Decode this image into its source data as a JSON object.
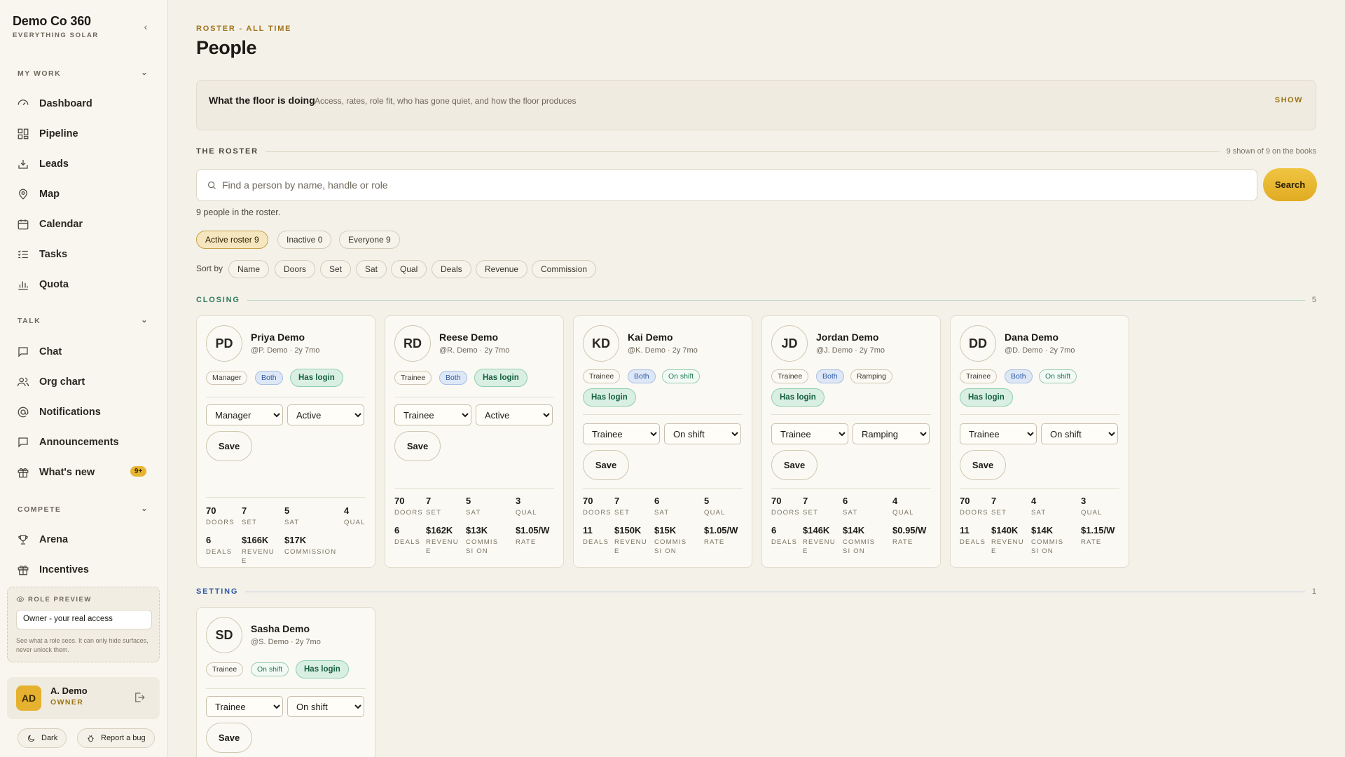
{
  "brand": {
    "title": "Demo Co 360",
    "subtitle": "EVERYTHING SOLAR"
  },
  "nav": {
    "my_work": "MY WORK",
    "talk": "TALK",
    "compete": "COMPETE",
    "items": {
      "dashboard": "Dashboard",
      "pipeline": "Pipeline",
      "leads": "Leads",
      "map": "Map",
      "calendar": "Calendar",
      "tasks": "Tasks",
      "quota": "Quota",
      "chat": "Chat",
      "org_chart": "Org chart",
      "notifications": "Notifications",
      "announcements": "Announcements",
      "whats_new": "What's new",
      "whats_new_badge": "9+",
      "arena": "Arena",
      "incentives": "Incentives"
    }
  },
  "role_preview": {
    "title": "ROLE PREVIEW",
    "value": "Owner - your real access",
    "help": "See what a role sees. It can only hide surfaces, never unlock them."
  },
  "user": {
    "initials": "AD",
    "name": "A. Demo",
    "role": "OWNER"
  },
  "footer": {
    "dark": "Dark",
    "bug": "Report a bug"
  },
  "header": {
    "eyebrow": "ROSTER - ALL TIME",
    "title": "People"
  },
  "floor": {
    "title": "What the floor is doing",
    "desc": "Access, rates, role fit, who has gone quiet, and how the floor produces",
    "show": "SHOW"
  },
  "roster": {
    "title": "THE ROSTER",
    "shown": "9 shown of 9 on the books",
    "search_placeholder": "Find a person by name, handle or role",
    "search_button": "Search",
    "count_text": "9 people in the roster.",
    "filters": {
      "active": "Active roster  9",
      "inactive": "Inactive  0",
      "everyone": "Everyone  9"
    },
    "sort_label": "Sort by",
    "sort": [
      "Name",
      "Doors",
      "Set",
      "Sat",
      "Qual",
      "Deals",
      "Revenue",
      "Commission"
    ]
  },
  "sections": {
    "closing": {
      "title": "CLOSING",
      "count": "5",
      "color": "#2f7a5a"
    },
    "setting": {
      "title": "SETTING",
      "count": "1",
      "color": "#2f5aa6"
    }
  },
  "stat_labels": {
    "doors": "DOORS",
    "set": "SET",
    "sat": "SAT",
    "qual": "QUAL",
    "deals": "DEALS",
    "revenue": "REVENUE",
    "commission": "COMMISSION",
    "commission_wrap": "COMMISSI ON",
    "rate": "RATE"
  },
  "save_label": "Save",
  "people": [
    {
      "initials": "PD",
      "name": "Priya Demo",
      "handle": "@P. Demo · 2y 7mo",
      "role_tag": "Manager",
      "mode_tag": "Both",
      "login": "Has login",
      "role_sel": "Manager",
      "status_sel": "Active",
      "doors": "70",
      "set": "7",
      "sat": "5",
      "qual": "4",
      "deals": "6",
      "revenue": "$166K",
      "commission": "$17K"
    },
    {
      "initials": "RD",
      "name": "Reese Demo",
      "handle": "@R. Demo · 2y 7mo",
      "role_tag": "Trainee",
      "mode_tag": "Both",
      "login": "Has login",
      "role_sel": "Trainee",
      "status_sel": "Active",
      "doors": "70",
      "set": "7",
      "sat": "5",
      "qual": "3",
      "deals": "6",
      "revenue": "$162K",
      "commission": "$13K",
      "rate": "$1.05/W"
    },
    {
      "initials": "KD",
      "name": "Kai Demo",
      "handle": "@K. Demo · 2y 7mo",
      "role_tag": "Trainee",
      "mode_tag": "Both",
      "status_tag": "On shift",
      "login": "Has login",
      "role_sel": "Trainee",
      "status_sel": "On shift",
      "doors": "70",
      "set": "7",
      "sat": "6",
      "qual": "5",
      "deals": "11",
      "revenue": "$150K",
      "commission": "$15K",
      "rate": "$1.05/W"
    },
    {
      "initials": "JD",
      "name": "Jordan Demo",
      "handle": "@J. Demo · 2y 7mo",
      "role_tag": "Trainee",
      "mode_tag": "Both",
      "status_tag": "Ramping",
      "login": "Has login",
      "role_sel": "Trainee",
      "status_sel": "Ramping",
      "doors": "70",
      "set": "7",
      "sat": "6",
      "qual": "4",
      "deals": "6",
      "revenue": "$146K",
      "commission": "$14K",
      "rate": "$0.95/W"
    },
    {
      "initials": "DD",
      "name": "Dana Demo",
      "handle": "@D. Demo · 2y 7mo",
      "role_tag": "Trainee",
      "mode_tag": "Both",
      "status_tag": "On shift",
      "login": "Has login",
      "role_sel": "Trainee",
      "status_sel": "On shift",
      "doors": "70",
      "set": "7",
      "sat": "4",
      "qual": "3",
      "deals": "11",
      "revenue": "$140K",
      "commission": "$14K",
      "rate": "$1.15/W"
    },
    {
      "initials": "SD",
      "name": "Sasha Demo",
      "handle": "@S. Demo · 2y 7mo",
      "role_tag": "Trainee",
      "status_tag": "On shift",
      "login": "Has login",
      "role_sel": "Trainee",
      "status_sel": "On shift"
    }
  ],
  "options": {
    "roles": [
      "Manager",
      "Trainee"
    ],
    "statuses": [
      "Active",
      "On shift",
      "Ramping"
    ]
  }
}
